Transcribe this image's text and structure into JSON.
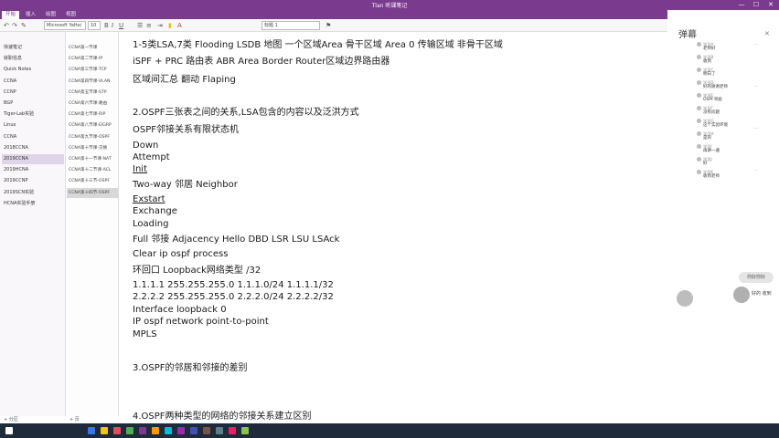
{
  "window": {
    "title": "Tlan 听课笔记",
    "min": "—",
    "max": "☐",
    "close": "✕"
  },
  "ribbon": {
    "tabs": [
      "开始",
      "插入",
      "绘图",
      "视图"
    ]
  },
  "toolbar": {
    "font_name": "Microsoft YaHei",
    "font_size": "10",
    "style": "标题 1",
    "icons": [
      "undo-icon",
      "redo-icon",
      "format-painter-icon",
      "bold-icon",
      "italic-icon",
      "underline-icon",
      "bullets-icon",
      "numbering-icon",
      "indent-icon",
      "highlight-icon",
      "font-color-icon",
      "tag-icon"
    ]
  },
  "sections": {
    "items": [
      "快速笔记",
      "就职信息",
      "Quick Notes",
      "CCNA",
      "CCNP",
      "BGP",
      "Tiger-Lab实验",
      "Linux",
      "CCNA",
      "2018CCNA",
      "2019CCNA",
      "2019HCNA",
      "2019CCNP",
      "2019SCN实验",
      "HCNA实验手册"
    ],
    "selected_index": 10,
    "add_label": "+ 分区"
  },
  "pages": {
    "items": [
      "CCNA第一节课",
      "CCNA第二节课-IP",
      "CCNA第三节课-TCP",
      "CCNA第四节课-VLAN",
      "CCNA第五节课-STP",
      "CCNA第六节课-路由",
      "CCNA第七节课-RIP",
      "CCNA第八节课-EIGRP",
      "CCNA第九节课-OSPF",
      "CCNA第十节课-交换",
      "CCNA第十一节课-NAT",
      "CCNA第十二节课-ACL",
      "CCNA第十三节-OSPF",
      "CCNA第十四节-OSPF"
    ],
    "selected_index": 13,
    "add_label": "+ 页"
  },
  "note": {
    "lines": [
      {
        "text": "1-5类LSA,7类  Flooding  LSDB 地图  一个区域Area  骨干区域 Area 0 传输区域 非骨干区域",
        "u": false
      },
      {
        "text": "iSPF + PRC 路由表  ABR Area Border Router区域边界路由器",
        "u": false
      },
      {
        "text": "区域间汇总  翻动 Flaping",
        "u": false
      },
      {
        "text": "2.OSPF三张表之间的关系,LSA包含的内容以及泛洪方式",
        "u": false
      },
      {
        "text": "OSPF邻接关系有限状态机",
        "u": false
      },
      {
        "text": "Down",
        "u": false
      },
      {
        "text": "Attempt",
        "u": false
      },
      {
        "text": "Init",
        "u": true
      },
      {
        "text": "Two-way     邻居 Neighbor",
        "u": false
      },
      {
        "text": "Exstart",
        "u": true
      },
      {
        "text": "Exchange",
        "u": false
      },
      {
        "text": "Loading",
        "u": false
      },
      {
        "text": "Full            邻接 Adjacency   Hello DBD LSR LSU LSAck",
        "u": false
      },
      {
        "text": "Clear ip ospf process",
        "u": false
      },
      {
        "text": "环回口 Loopback网络类型 /32",
        "u": false
      },
      {
        "text": "1.1.1.1 255.255.255.0               1.1.1.0/24       1.1.1.1/32",
        "u": false
      },
      {
        "text": "2.2.2.2 255.255.255.0               2.2.2.0/24       2.2.2.2/32",
        "u": false
      },
      {
        "text": "Interface loopback 0",
        "u": false
      },
      {
        "text": " IP ospf network point-to-point",
        "u": false
      },
      {
        "text": "MPLS",
        "u": false
      },
      {
        "text": "3.OSPF的邻居和邻接的差别",
        "u": false
      },
      {
        "text": "4.OSPF两种类型的网络的邻接关系建立区别",
        "u": false
      }
    ]
  },
  "chat": {
    "header": "弹幕",
    "close": "✕",
    "messages": [
      {
        "name": "学员A",
        "body": "老师好"
      },
      {
        "name": "学员B",
        "body": "收到"
      },
      {
        "name": "学员C",
        "body": "明白了"
      },
      {
        "name": "学员D",
        "body": "好的谢谢老师"
      },
      {
        "name": "学员E",
        "body": "OSPF邻居"
      },
      {
        "name": "学员F",
        "body": "没有问题"
      },
      {
        "name": "学员G",
        "body": "这个实验环境"
      },
      {
        "name": "学员H",
        "body": "是的"
      },
      {
        "name": "学员I",
        "body": "再讲一遍"
      },
      {
        "name": "学员J",
        "body": "好"
      },
      {
        "name": "学员K",
        "body": "收到老师"
      }
    ],
    "bubble": "你好你好",
    "bubble_reply": "好的 收到"
  },
  "taskbar": {
    "time": "",
    "colors": [
      "#2b7de9",
      "#f0c419",
      "#e84a5f",
      "#4caf50",
      "#7a3b8e",
      "#ff9800",
      "#00bcd4",
      "#9c27b0",
      "#3f51b5",
      "#795548",
      "#607d8b",
      "#e91e63",
      "#8bc34a"
    ]
  }
}
